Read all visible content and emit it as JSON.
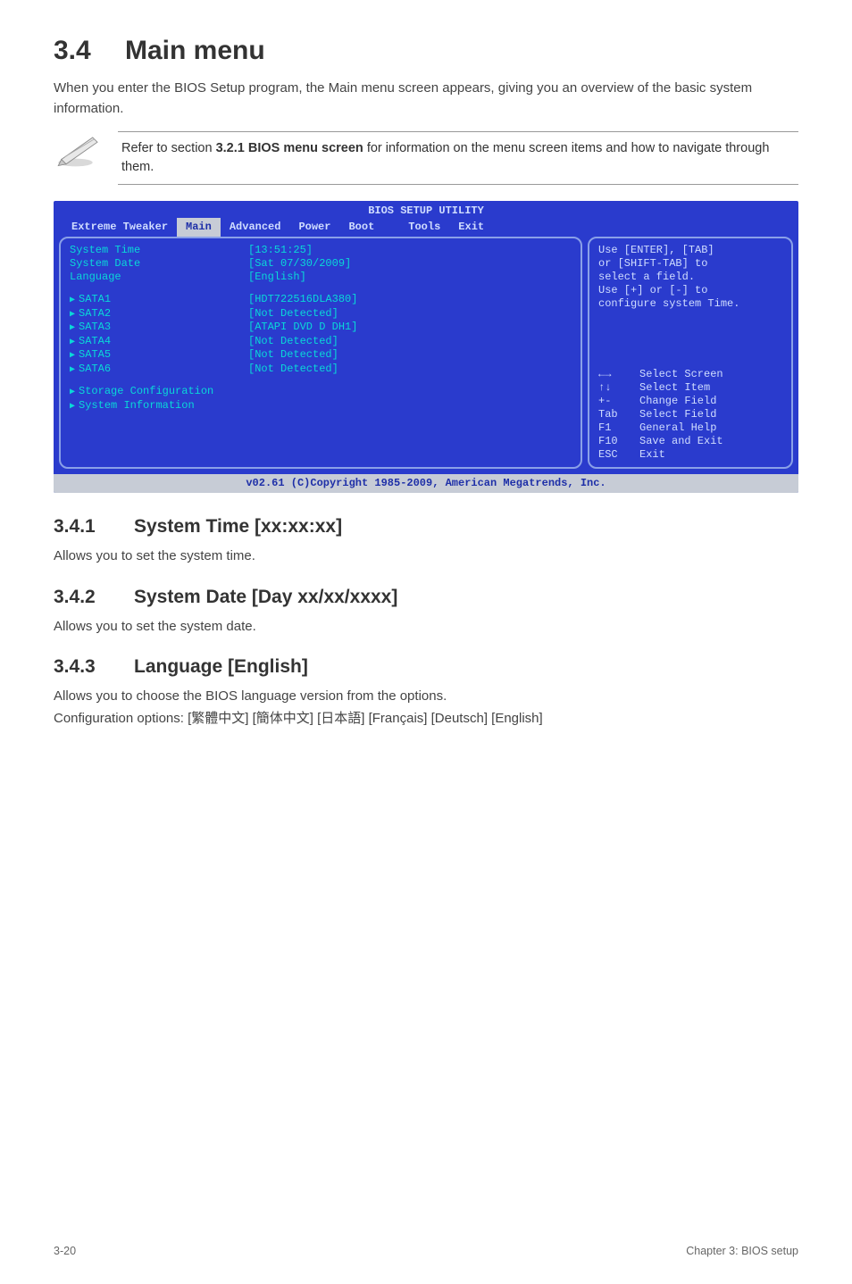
{
  "heading": {
    "num": "3.4",
    "title": "Main menu"
  },
  "intro": "When you enter the BIOS Setup program, the Main menu screen appears, giving you an overview of the basic system information.",
  "note": {
    "text_pre": "Refer to section ",
    "bold": "3.2.1 BIOS menu screen",
    "text_post": " for information on the menu screen items and how to navigate through them."
  },
  "bios": {
    "title": "BIOS SETUP UTILITY",
    "tabs": [
      "Extreme Tweaker",
      "Main",
      "Advanced",
      "Power",
      "Boot",
      "Tools",
      "Exit"
    ],
    "active_tab": "Main",
    "left_top": [
      {
        "label": "System Time",
        "value": "[13:51:25]"
      },
      {
        "label": "System Date",
        "value": "[Sat 07/30/2009]"
      },
      {
        "label": "Language",
        "value": "[English]"
      }
    ],
    "left_sata": [
      {
        "label": "SATA1",
        "value": "[HDT722516DLA380]"
      },
      {
        "label": "SATA2",
        "value": "[Not Detected]"
      },
      {
        "label": "SATA3",
        "value": "[ATAPI DVD D DH1]"
      },
      {
        "label": "SATA4",
        "value": "[Not Detected]"
      },
      {
        "label": "SATA5",
        "value": "[Not Detected]"
      },
      {
        "label": "SATA6",
        "value": "[Not Detected]"
      }
    ],
    "left_bottom": [
      "Storage Configuration",
      "System Information"
    ],
    "right_top": [
      "Use [ENTER], [TAB]",
      "or [SHIFT-TAB] to",
      "select a field.",
      "",
      "Use [+] or [-] to",
      "configure system Time."
    ],
    "right_keys": [
      {
        "k": "←→",
        "v": "Select Screen"
      },
      {
        "k": "↑↓",
        "v": "Select Item"
      },
      {
        "k": "+-",
        "v": "Change Field"
      },
      {
        "k": "Tab",
        "v": "Select Field"
      },
      {
        "k": "F1",
        "v": "General Help"
      },
      {
        "k": "F10",
        "v": "Save and Exit"
      },
      {
        "k": "ESC",
        "v": "Exit"
      }
    ],
    "footer": "v02.61 (C)Copyright 1985-2009, American Megatrends, Inc."
  },
  "sec341": {
    "num": "3.4.1",
    "title": "System Time [xx:xx:xx]",
    "body": "Allows you to set the system time."
  },
  "sec342": {
    "num": "3.4.2",
    "title": "System Date [Day xx/xx/xxxx]",
    "body": "Allows you to set the system date."
  },
  "sec343": {
    "num": "3.4.3",
    "title": "Language [English]",
    "body1": "Allows you to choose the BIOS language version from the options.",
    "body2": "Configuration options: [繁體中文] [簡体中文] [日本語] [Français] [Deutsch] [English]"
  },
  "page_footer": {
    "left": "3-20",
    "right": "Chapter 3: BIOS setup"
  }
}
